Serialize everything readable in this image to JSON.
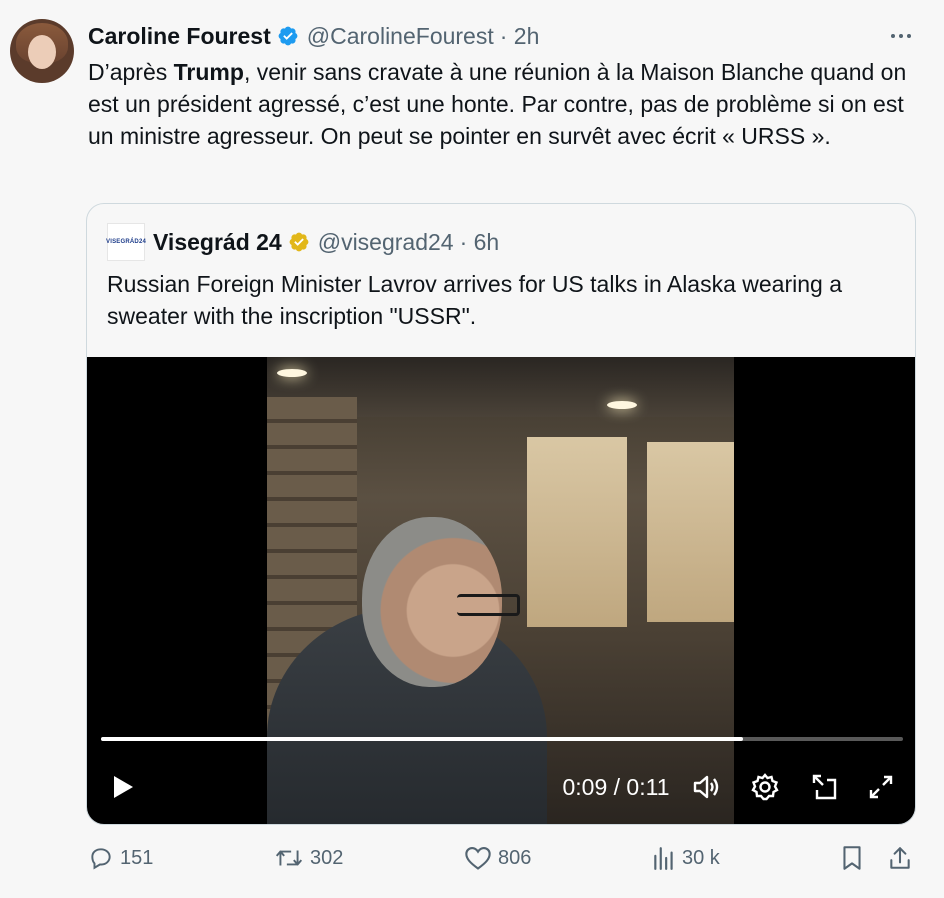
{
  "tweet": {
    "author_name": "Caroline Fourest",
    "handle": "@CarolineFourest",
    "time": "· 2h",
    "text_before": "D’après ",
    "text_bold": "Trump",
    "text_after": ", venir sans cravate à une réunion à la Maison Blanche quand on est un président agressé, c’est une honte. Par contre, pas de problème si on est un ministre agresseur. On peut se pointer en survêt avec écrit « URSS »."
  },
  "quote": {
    "logo_text": "VISEGRÁD24",
    "author_name": "Visegrád 24",
    "handle": "@visegrad24",
    "time": "· 6h",
    "text": "Russian Foreign Minister Lavrov arrives for US talks in Alaska wearing a sweater with the inscription \"USSR\"."
  },
  "video": {
    "time_display": "0:09 / 0:11",
    "progress": 0.8
  },
  "actions": {
    "replies": "151",
    "reposts": "302",
    "likes": "806",
    "views": "30 k"
  },
  "colors": {
    "verified_blue": "#1d9bf0",
    "verified_gold": "#e2b719",
    "muted": "#536471"
  },
  "icons": [
    "verified-icon",
    "more-icon",
    "play-icon",
    "volume-icon",
    "settings-icon",
    "pip-icon",
    "fullscreen-icon",
    "reply-icon",
    "repost-icon",
    "like-icon",
    "views-icon",
    "bookmark-icon",
    "share-icon"
  ]
}
